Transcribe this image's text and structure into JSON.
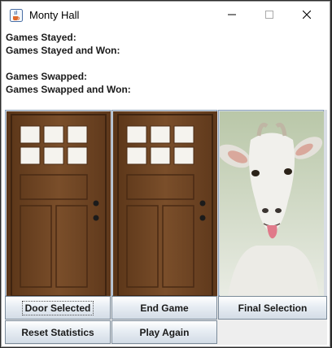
{
  "window": {
    "title": "Monty Hall",
    "icon": "java-cup-icon"
  },
  "stats": {
    "games_stayed_label": "Games Stayed:",
    "games_stayed_won_label": "Games Stayed and Won:",
    "games_swapped_label": "Games Swapped:",
    "games_swapped_won_label": "Games Swapped and Won:"
  },
  "doors": [
    {
      "content": "door",
      "icon": "door-icon"
    },
    {
      "content": "door",
      "icon": "door-icon"
    },
    {
      "content": "goat",
      "icon": "goat-icon"
    }
  ],
  "buttons": {
    "door_selected": "Door Selected",
    "end_game": "End Game",
    "final_selection": "Final Selection",
    "reset_statistics": "Reset Statistics",
    "play_again": "Play Again"
  },
  "colors": {
    "door_wood": "#6b4424",
    "button_border": "#7a8a99"
  }
}
